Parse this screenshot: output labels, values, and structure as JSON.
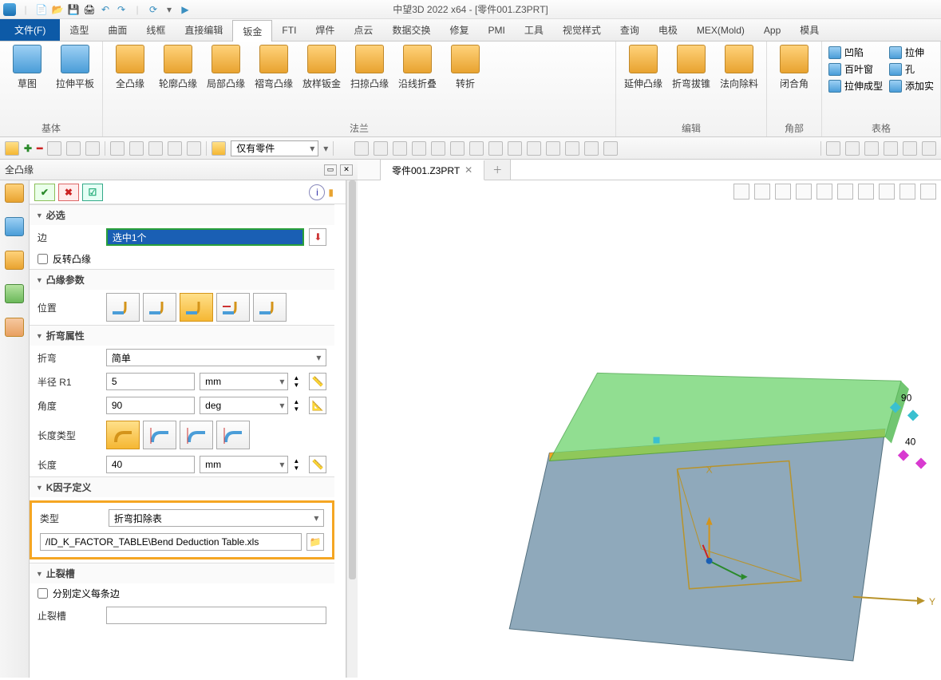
{
  "app": {
    "title": "中望3D 2022 x64 - [零件001.Z3PRT]"
  },
  "tab_doc": {
    "name": "零件001.Z3PRT"
  },
  "menu": {
    "file": "文件(F)",
    "items": [
      "造型",
      "曲面",
      "线框",
      "直接编辑",
      "钣金",
      "FTI",
      "焊件",
      "点云",
      "数据交换",
      "修复",
      "PMI",
      "工具",
      "视觉样式",
      "查询",
      "电极",
      "MEX(Mold)",
      "App",
      "模具"
    ],
    "active_index": 4
  },
  "ribbon": {
    "groups": [
      {
        "label": "基体",
        "tools": [
          {
            "cap": "草图",
            "blue": true
          },
          {
            "cap": "拉伸平板",
            "blue": true
          }
        ]
      },
      {
        "label": "法兰",
        "tools": [
          {
            "cap": "全凸缘"
          },
          {
            "cap": "轮廓凸缘"
          },
          {
            "cap": "局部凸缘"
          },
          {
            "cap": "褶弯凸缘"
          },
          {
            "cap": "放样钣金"
          },
          {
            "cap": "扫掠凸缘"
          },
          {
            "cap": "沿线折叠"
          },
          {
            "cap": "转折"
          }
        ]
      },
      {
        "label": "编辑",
        "tools": [
          {
            "cap": "延伸凸缘"
          },
          {
            "cap": "折弯拔锥"
          },
          {
            "cap": "法向除料"
          }
        ]
      },
      {
        "label": "角部",
        "tools": [
          {
            "cap": "闭合角"
          }
        ]
      },
      {
        "label": "表格",
        "mini": [
          "凹陷",
          "拉伸",
          "百叶窗",
          "孔",
          "拉伸成型",
          "添加实"
        ]
      }
    ]
  },
  "toolbar2": {
    "combo": "仅有零件"
  },
  "panel": {
    "title": "全凸缘",
    "sections": {
      "required": "必选",
      "edge_label": "边",
      "edge_value": "选中1个",
      "reverse": "反转凸缘",
      "flange": "凸缘参数",
      "position": "位置",
      "bend_attr": "折弯属性",
      "bend": "折弯",
      "bend_value": "简单",
      "radius": "半径 R1",
      "radius_value": "5",
      "radius_unit": "mm",
      "angle": "角度",
      "angle_value": "90",
      "angle_unit": "deg",
      "length_type": "长度类型",
      "length": "长度",
      "length_value": "40",
      "length_unit": "mm",
      "kfactor": "K因子定义",
      "ktype": "类型",
      "ktype_value": "折弯扣除表",
      "kfile": "/ID_K_FACTOR_TABLE\\Bend Deduction Table.xls",
      "relief": "止裂槽",
      "relief_each": "分别定义每条边",
      "relief2": "止裂槽"
    }
  },
  "viewport": {
    "dims": {
      "a": "90",
      "b": "40"
    },
    "axes": {
      "x": "X",
      "y": "Y"
    }
  }
}
